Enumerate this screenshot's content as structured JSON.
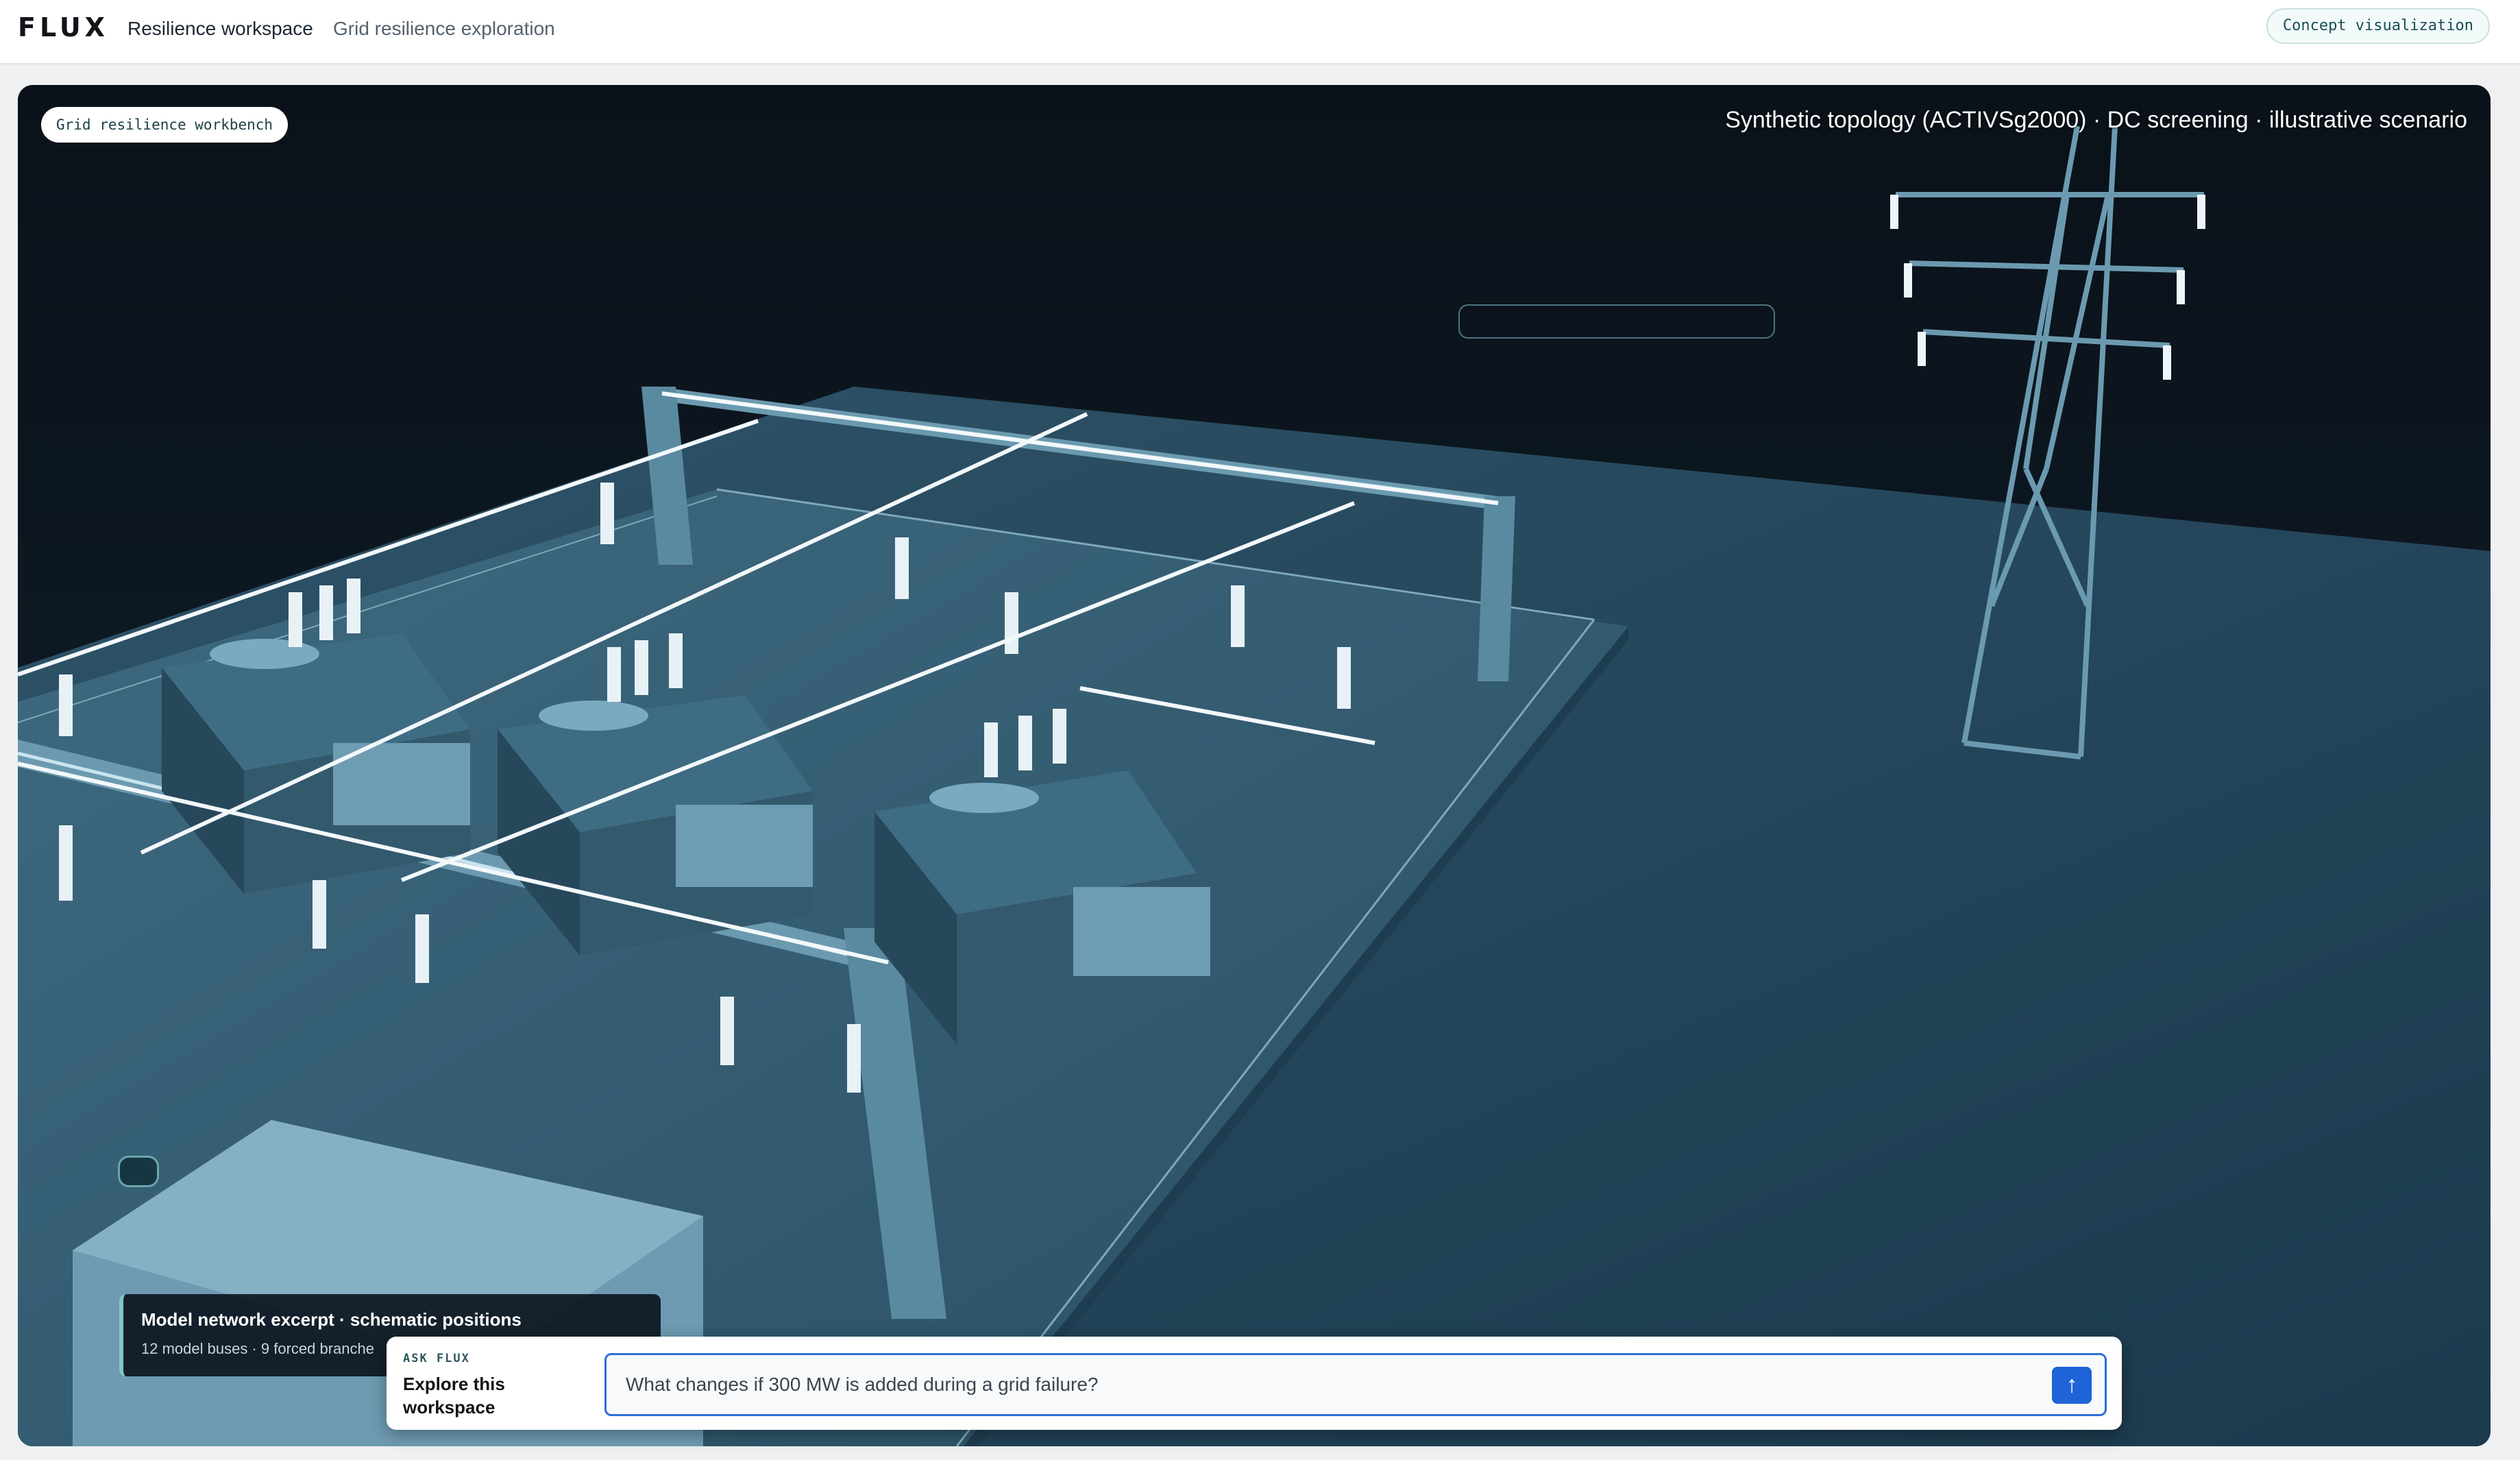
{
  "header": {
    "brand": "FLUX",
    "nav": [
      "Resilience workspace",
      "Grid resilience exploration"
    ],
    "concept_badge": "Concept visualization"
  },
  "scene": {
    "workbench_label": "Grid resilience workbench",
    "caption": "Synthetic topology (ACTIVSg2000) · DC screening · illustrative scenario",
    "background_color": "#0c1520",
    "ground_color": "#244558",
    "equipment_color": "#5a8aa0",
    "conductor_color": "#ffffff"
  },
  "excerpt": {
    "title": "Model network excerpt · schematic positions",
    "subtitle": "12 model buses · 9 forced branche"
  },
  "ask": {
    "kicker": "ASK FLUX",
    "heading": "Explore this workspace",
    "input_value": "What changes if 300 MW is added during a grid failure?",
    "send_icon": "arrow-up-icon"
  }
}
